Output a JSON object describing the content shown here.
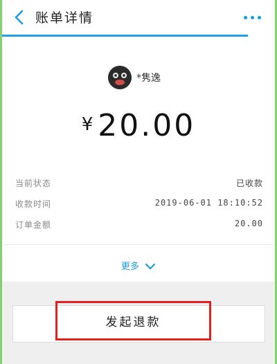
{
  "header": {
    "title": "账单详情"
  },
  "merchant": {
    "name": "*隽逸"
  },
  "amount": {
    "currency_symbol": "¥",
    "value": "20.00"
  },
  "details": [
    {
      "label": "当前状态",
      "value": "已收款"
    },
    {
      "label": "收款时间",
      "value": "2019-06-01 18:10:52"
    },
    {
      "label": "订单金额",
      "value": "20.00"
    }
  ],
  "more_link": {
    "label": "更多"
  },
  "actions": {
    "refund_label": "发起退款"
  },
  "colors": {
    "accent": "#1a9be0",
    "highlight": "#e41f1f",
    "edge": "#7fd36a"
  }
}
